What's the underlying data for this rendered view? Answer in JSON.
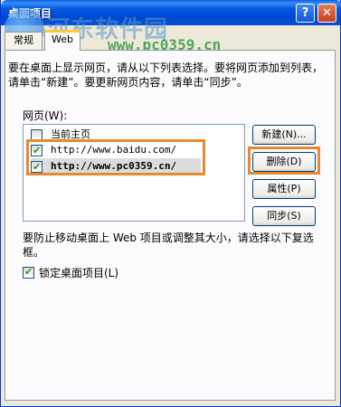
{
  "window": {
    "title": "桌面项目",
    "help_glyph": "?",
    "close_glyph": "✕"
  },
  "watermark": {
    "text": "河东软件园",
    "url": "www.pc0359.cn"
  },
  "tabs": [
    {
      "label": "常规"
    },
    {
      "label": "Web"
    }
  ],
  "description": "要在桌面上显示网页，请从以下列表选择。要将网页添加到列表，请单击“新建”。要更新网页内容，请单击“同步”。",
  "web_pages_label": "网页(W):",
  "list": [
    {
      "label": "当前主页",
      "checked": false
    },
    {
      "label": "http://www.baidu.com/",
      "checked": true
    },
    {
      "label": "http://www.pc0359.cn/",
      "checked": true
    }
  ],
  "buttons": {
    "new": "新建(N)...",
    "delete": "删除(D)",
    "properties": "属性(P)",
    "sync": "同步(S)"
  },
  "hint": "要防止移动桌面上 Web 项目或调整其大小，请选择以下复选框。",
  "lock": {
    "label": "锁定桌面项目(L)",
    "checked": true
  },
  "colors": {
    "highlight": "#e8892f",
    "titlebar": "#0058e0"
  }
}
